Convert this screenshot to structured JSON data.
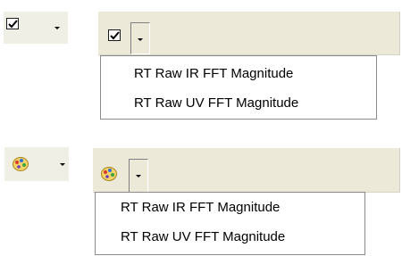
{
  "menus": {
    "checkbox_dropdown": {
      "items": [
        {
          "label": "RT Raw IR FFT Magnitude"
        },
        {
          "label": "RT Raw UV FFT Magnitude"
        }
      ]
    },
    "palette_dropdown": {
      "items": [
        {
          "label": "RT Raw IR FFT Magnitude"
        },
        {
          "label": "RT Raw UV FFT Magnitude"
        }
      ]
    }
  },
  "icons": {
    "checkbox": "checkbox-checked-icon",
    "palette": "color-palette-icon",
    "dropdown": "chevron-down-icon"
  },
  "colors": {
    "toolbar": "#ece9d8",
    "menu_background": "#ffffff",
    "menu_border": "#8a8a8a"
  }
}
